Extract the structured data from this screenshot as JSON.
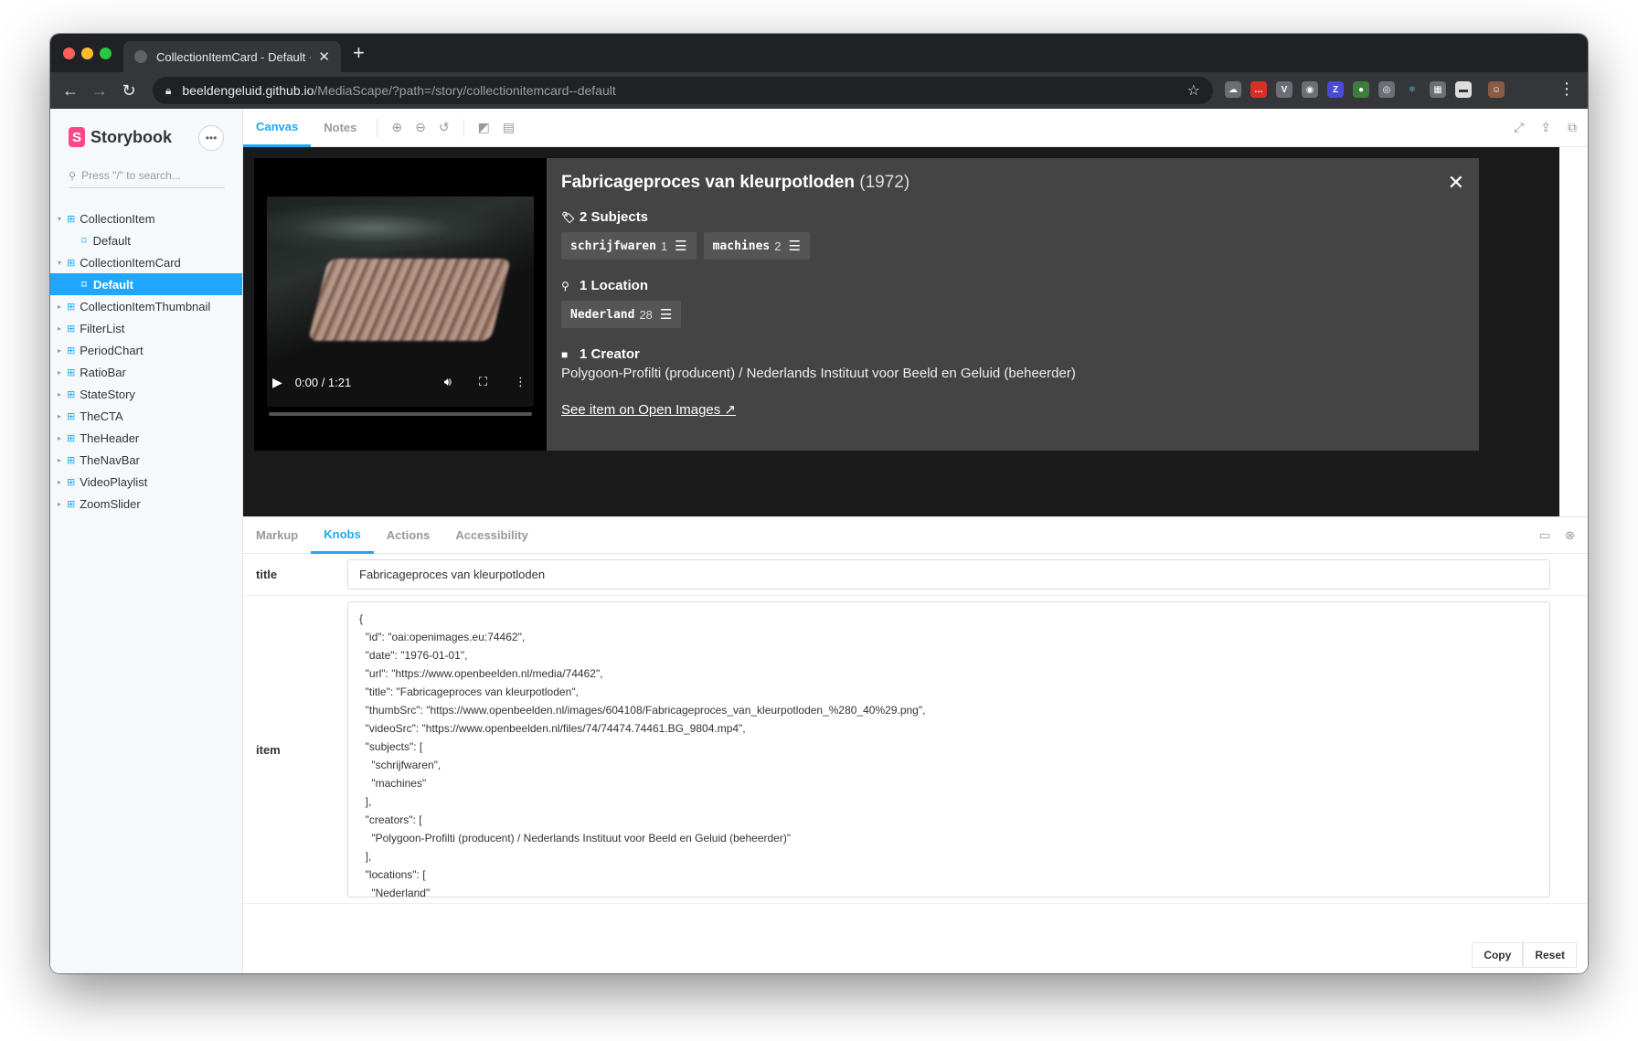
{
  "browser": {
    "tab_title": "CollectionItemCard - Default ·",
    "tab_close": "✕",
    "new_tab": "+",
    "url_host": "beeldengeluid.github.io",
    "url_path": "/MediaScape/?path=/story/collectionitemcard--default",
    "extensions": [
      "☁",
      "…",
      "V",
      "◉",
      "Z",
      "●",
      "◎",
      "⚛",
      "▦",
      "▬",
      "☺"
    ]
  },
  "sidebar": {
    "brand": "Storybook",
    "search_placeholder": "Press \"/\" to search...",
    "items": [
      {
        "label": "CollectionItem",
        "expanded": true,
        "children": [
          "Default"
        ]
      },
      {
        "label": "CollectionItemCard",
        "expanded": true,
        "children": [
          "Default"
        ],
        "selected_child": 0
      },
      {
        "label": "CollectionItemThumbnail"
      },
      {
        "label": "FilterList"
      },
      {
        "label": "PeriodChart"
      },
      {
        "label": "RatioBar"
      },
      {
        "label": "StateStory"
      },
      {
        "label": "TheCTA"
      },
      {
        "label": "TheHeader"
      },
      {
        "label": "TheNavBar"
      },
      {
        "label": "VideoPlaylist"
      },
      {
        "label": "ZoomSlider"
      }
    ]
  },
  "canvas": {
    "tabs": [
      "Canvas",
      "Notes"
    ],
    "active_tab": "Canvas"
  },
  "card": {
    "title": "Fabricageproces van kleurpotloden",
    "year": "(1972)",
    "video_time": "0:00 / 1:21",
    "subjects_heading": "2 Subjects",
    "subjects": [
      {
        "name": "schrijfwaren",
        "count": "1"
      },
      {
        "name": "machines",
        "count": "2"
      }
    ],
    "location_heading": "1 Location",
    "locations": [
      {
        "name": "Nederland",
        "count": "28"
      }
    ],
    "creator_heading": "1 Creator",
    "creator_text": "Polygoon-Profilti (producent) / Nederlands Instituut voor Beeld en Geluid (beheerder)",
    "link_text": "See item on Open Images ↗"
  },
  "addons": {
    "tabs": [
      "Markup",
      "Knobs",
      "Actions",
      "Accessibility"
    ],
    "active_tab": "Knobs",
    "knobs": {
      "title_label": "title",
      "title_value": "Fabricageproces van kleurpotloden",
      "item_label": "item",
      "item_value": "{\n  \"id\": \"oai:openimages.eu:74462\",\n  \"date\": \"1976-01-01\",\n  \"url\": \"https://www.openbeelden.nl/media/74462\",\n  \"title\": \"Fabricageproces van kleurpotloden\",\n  \"thumbSrc\": \"https://www.openbeelden.nl/images/604108/Fabricageproces_van_kleurpotloden_%280_40%29.png\",\n  \"videoSrc\": \"https://www.openbeelden.nl/files/74/74474.74461.BG_9804.mp4\",\n  \"subjects\": [\n    \"schrijfwaren\",\n    \"machines\"\n  ],\n  \"creators\": [\n    \"Polygoon-Profilti (producent) / Nederlands Instituut voor Beeld en Geluid (beheerder)\"\n  ],\n  \"locations\": [\n    \"Nederland\"\n  ]\n}"
    },
    "copy_label": "Copy",
    "reset_label": "Reset"
  },
  "colors": {
    "accent": "#1ea7fd",
    "storybook_pink": "#ff4785",
    "card_bg": "#444444",
    "preview_bg": "#1a1a1a"
  }
}
